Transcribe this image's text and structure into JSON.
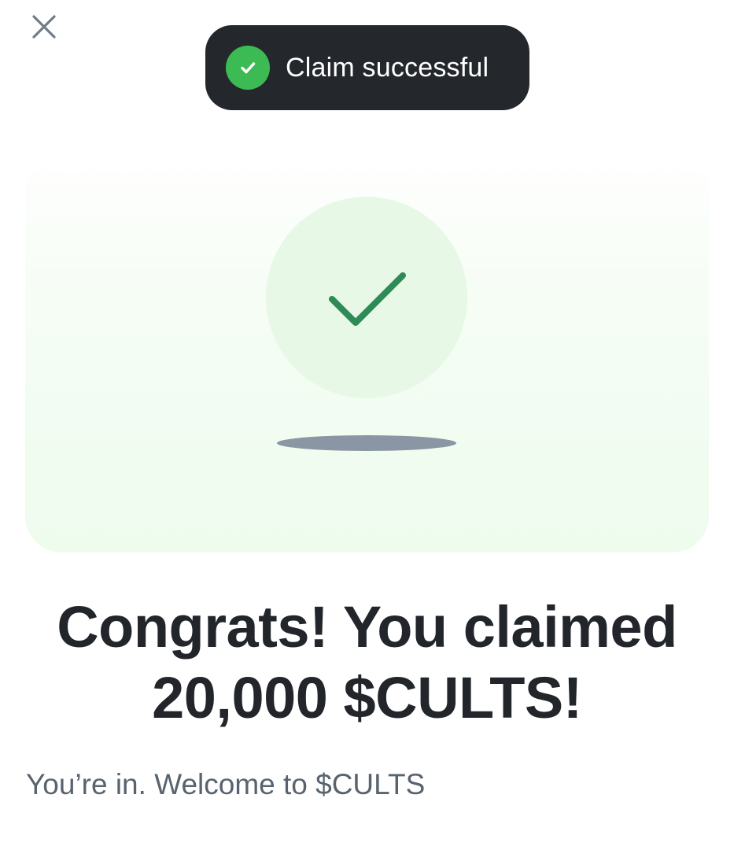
{
  "toast": {
    "message": "Claim successful",
    "icon": "check-circle-icon",
    "background_color": "#24282d",
    "icon_color": "#3cba54"
  },
  "header": {
    "close_icon": "close-icon"
  },
  "hero": {
    "icon": "checkmark-icon",
    "accent_color": "#2e8b57",
    "circle_color": "#e7f8e6"
  },
  "content": {
    "headline_line1": "Congrats! You claimed",
    "headline_line2": "20,000 $CULTS!",
    "subtitle": "You’re in. Welcome to $CULTS"
  }
}
